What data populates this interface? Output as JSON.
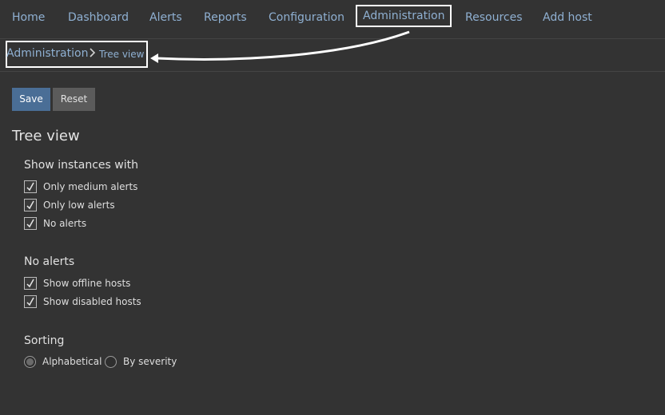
{
  "nav": {
    "items": [
      {
        "label": "Home"
      },
      {
        "label": "Dashboard"
      },
      {
        "label": "Alerts"
      },
      {
        "label": "Reports"
      },
      {
        "label": "Configuration"
      },
      {
        "label": "Administration",
        "active": true
      },
      {
        "label": "Resources"
      },
      {
        "label": "Add host"
      }
    ]
  },
  "breadcrumb": {
    "root": "Administration",
    "current": "Tree view"
  },
  "toolbar": {
    "save_label": "Save",
    "reset_label": "Reset"
  },
  "page": {
    "title": "Tree view"
  },
  "groups": {
    "show_instances": {
      "title": "Show instances with",
      "options": [
        {
          "label": "Only medium alerts",
          "checked": true
        },
        {
          "label": "Only low alerts",
          "checked": true
        },
        {
          "label": "No alerts",
          "checked": true
        }
      ]
    },
    "no_alerts": {
      "title": "No alerts",
      "options": [
        {
          "label": "Show offline hosts",
          "checked": true
        },
        {
          "label": "Show disabled hosts",
          "checked": true
        }
      ]
    },
    "sorting": {
      "title": "Sorting",
      "options": [
        {
          "label": "Alphabetical",
          "selected": true
        },
        {
          "label": "By severity",
          "selected": false
        }
      ]
    }
  },
  "colors": {
    "background": "#333333",
    "link": "#8fb0d2",
    "primary_button": "#4a6e96",
    "secondary_button": "#5b5b5b",
    "annotation": "#ffffff"
  }
}
